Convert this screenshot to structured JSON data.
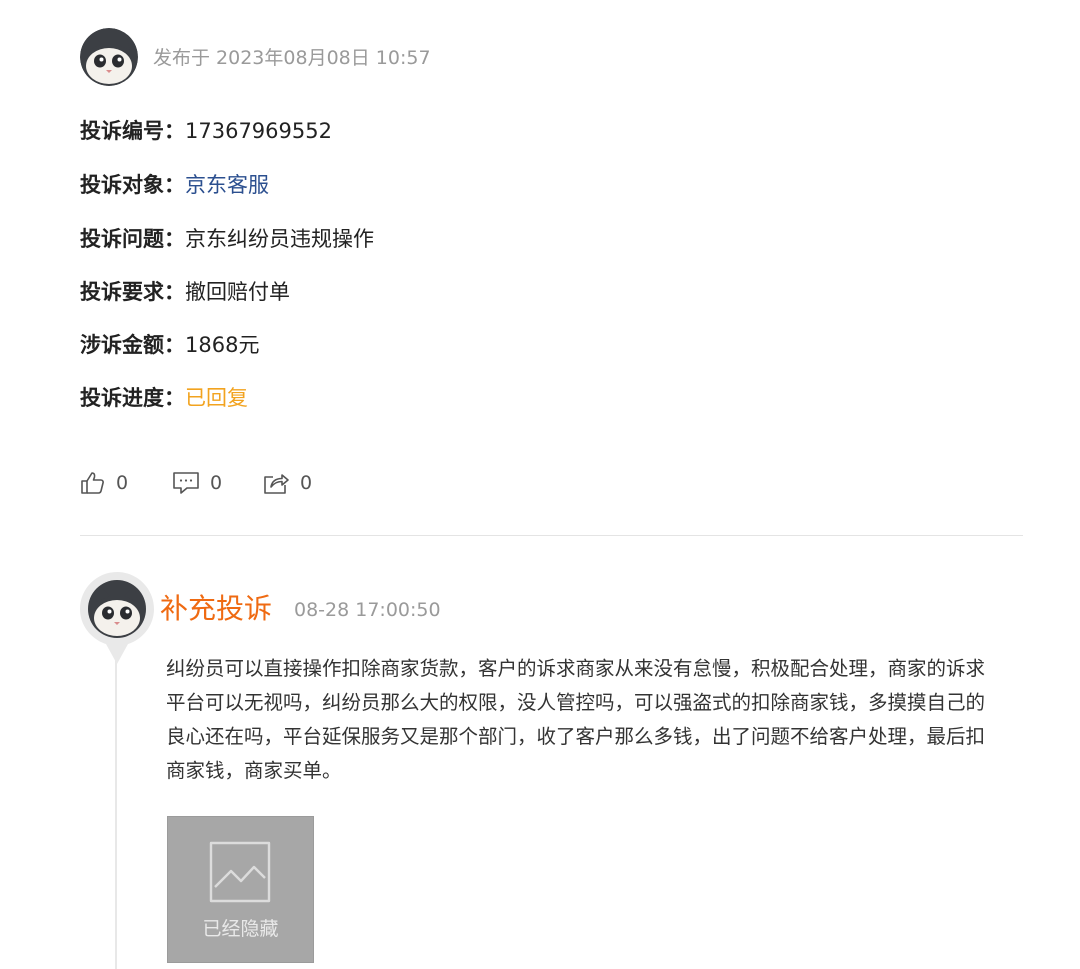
{
  "post": {
    "date": "发布于 2023年08月08日 10:57"
  },
  "fields": [
    {
      "label": "投诉编号：",
      "value": "17367969552"
    },
    {
      "label": "投诉对象：",
      "value": "京东客服"
    },
    {
      "label": "投诉问题：",
      "value": "京东纠纷员违规操作"
    },
    {
      "label": "投诉要求：",
      "value": "撤回赔付单"
    },
    {
      "label": "涉诉金额：",
      "value": "1868元"
    },
    {
      "label": "投诉进度：",
      "value": "已回复"
    }
  ],
  "actions": {
    "likes": "0",
    "comments": "0",
    "shares": "0"
  },
  "supplement": {
    "title": "补充投诉",
    "time": "08-28 17:00:50",
    "body": "纠纷员可以直接操作扣除商家货款，客户的诉求商家从来没有怠慢，积极配合处理，商家的诉求平台可以无视吗，纠纷员那么大的权限，没人管控吗，可以强盗式的扣除商家钱，多摸摸自己的良心还在吗，平台延保服务又是那个部门，收了客户那么多钱，出了问题不给客户处理，最后扣商家钱，商家买单。",
    "hidden_image_label": "已经隐藏"
  },
  "colors": {
    "link": "#2b4f8f",
    "status": "#f2a31f",
    "supplement_title": "#ef6a12",
    "muted": "#9a9a9a"
  },
  "icons": {
    "like": "thumbs-up-icon",
    "comment": "comment-icon",
    "share": "share-icon",
    "image": "image-placeholder-icon"
  }
}
